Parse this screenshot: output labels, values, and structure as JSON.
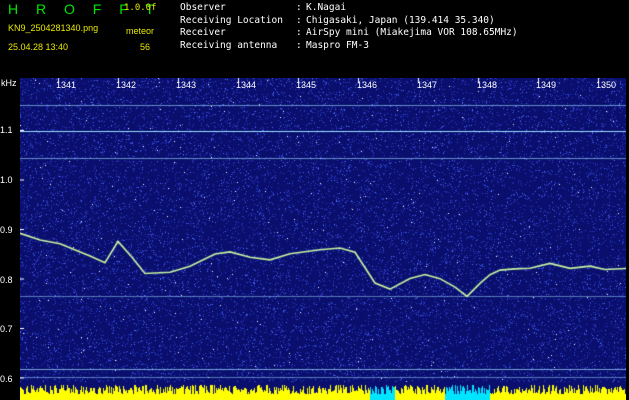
{
  "header": {
    "title": "H R O F F T",
    "version": "1.0.0f",
    "filename": "KN9_2504281340.png",
    "datetime": "25.04.28 13:40",
    "meteor_label": "meteor",
    "meteor_count": "56"
  },
  "info": [
    {
      "key": "Observer",
      "value": "K.Nagai"
    },
    {
      "key": "Receiving Location",
      "value": "Chigasaki, Japan (139.414 35.340)"
    },
    {
      "key": "Receiver",
      "value": "AirSpy mini (Miakejima VOR 108.65MHz)"
    },
    {
      "key": "Receiving antenna",
      "value": "Maspro FM-3"
    }
  ],
  "axis": {
    "y_unit": "kHz",
    "y_ticks": [
      "1.1",
      "1.0",
      "0.9",
      "0.8",
      "0.7",
      "0.6"
    ],
    "x_ticks": [
      "1341",
      "1342",
      "1343",
      "1344",
      "1345",
      "1346",
      "1347",
      "1348",
      "1349",
      "1350"
    ]
  },
  "colors": {
    "background": "#0a0f6e",
    "noise": "#2a3cc8",
    "line": "#9fe0ff",
    "trace": "#c8f5a0",
    "bar_yellow": "#ffff00",
    "bar_cyan": "#00e5ff"
  }
}
